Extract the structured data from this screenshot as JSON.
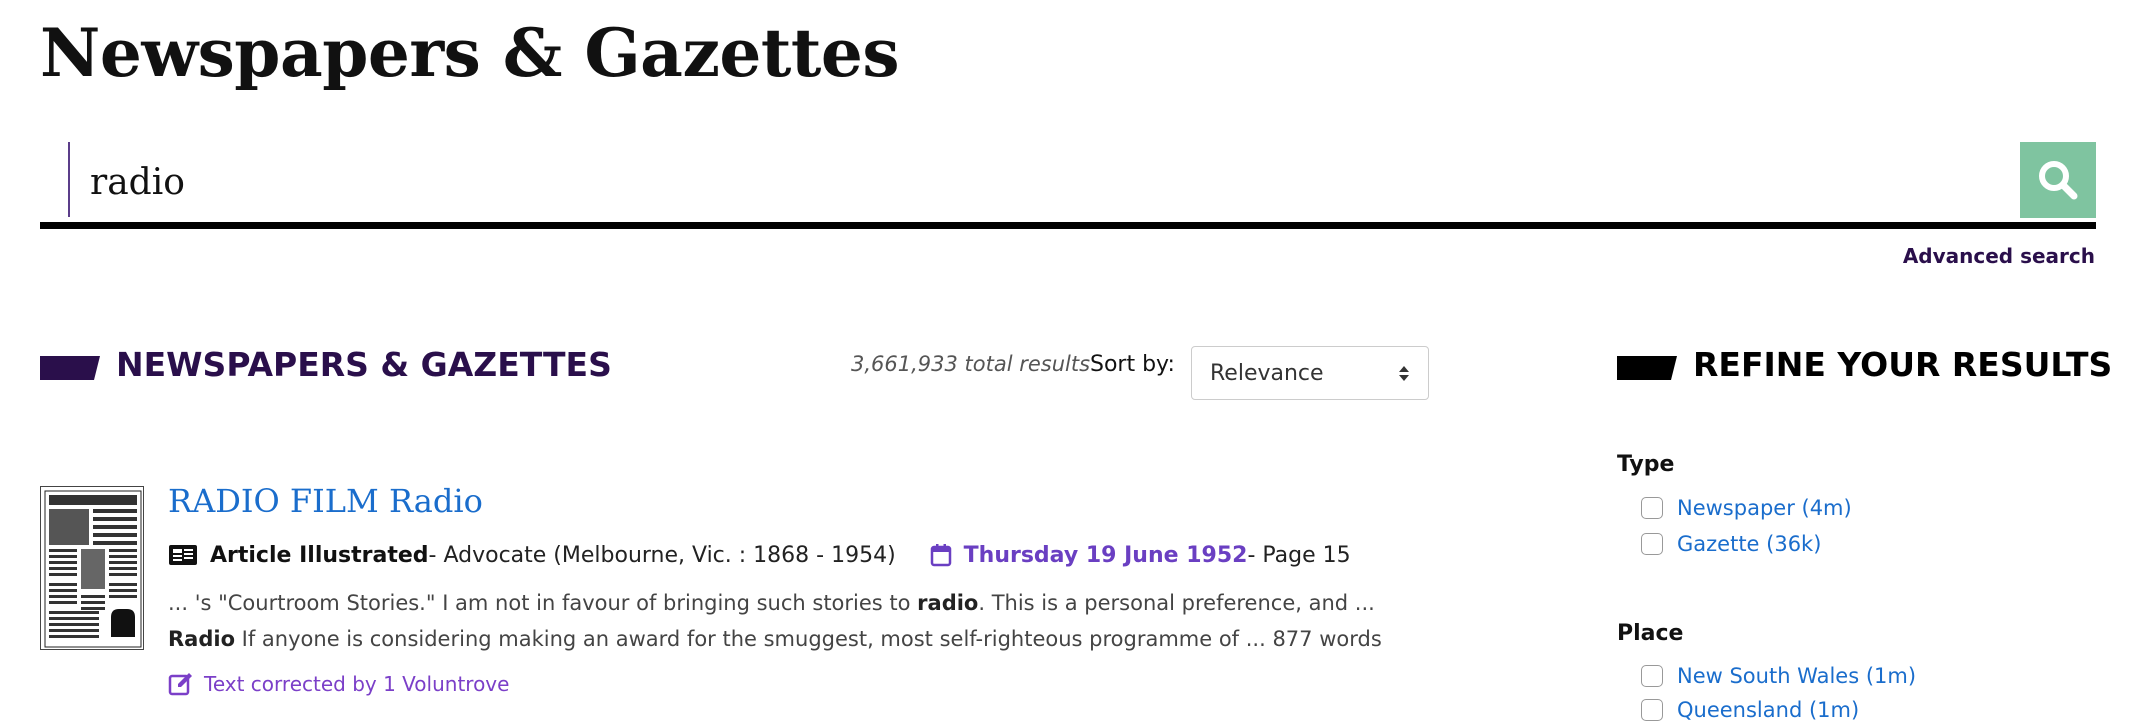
{
  "page": {
    "title": "Newspapers & Gazettes"
  },
  "search": {
    "value": "radio",
    "advanced_label": "Advanced search"
  },
  "results_header": {
    "heading": "NEWSPAPERS & GAZETTES",
    "total": "3,661,933 total results",
    "sort_label": "Sort by:",
    "sort_value": "Relevance"
  },
  "result": {
    "title": "RADIO FILM Radio",
    "category": "Article Illustrated",
    "source": " - Advocate (Melbourne, Vic. : 1868 - 1954)",
    "date": "Thursday 19 June 1952",
    "page": " - Page 15",
    "snippet": {
      "s1": "... 's \"Courtroom Stories.\" I am not in favour of bringing such stories to ",
      "h1": "radio",
      "s2": ". This is a personal preference, and ... ",
      "h2": "Radio",
      "s3": " If anyone is considering making an award for the smuggest, most self-righteous programme of ... 877 words"
    },
    "corrected": "Text corrected by 1 Voluntrove"
  },
  "refine": {
    "heading": "REFINE YOUR RESULTS",
    "type_title": "Type",
    "type_options": [
      "Newspaper (4m)",
      "Gazette (36k)"
    ],
    "place_title": "Place",
    "place_options": [
      "New South Wales (1m)",
      "Queensland (1m)"
    ]
  },
  "colors": {
    "accent_purple": "#2a0f4b",
    "link_blue": "#1a6dcc",
    "date_purple": "#6a3fc2",
    "search_button": "#7fc4a0"
  },
  "icons": [
    "search-icon",
    "article-icon",
    "calendar-icon",
    "edit-icon",
    "sort-arrows-icon"
  ]
}
